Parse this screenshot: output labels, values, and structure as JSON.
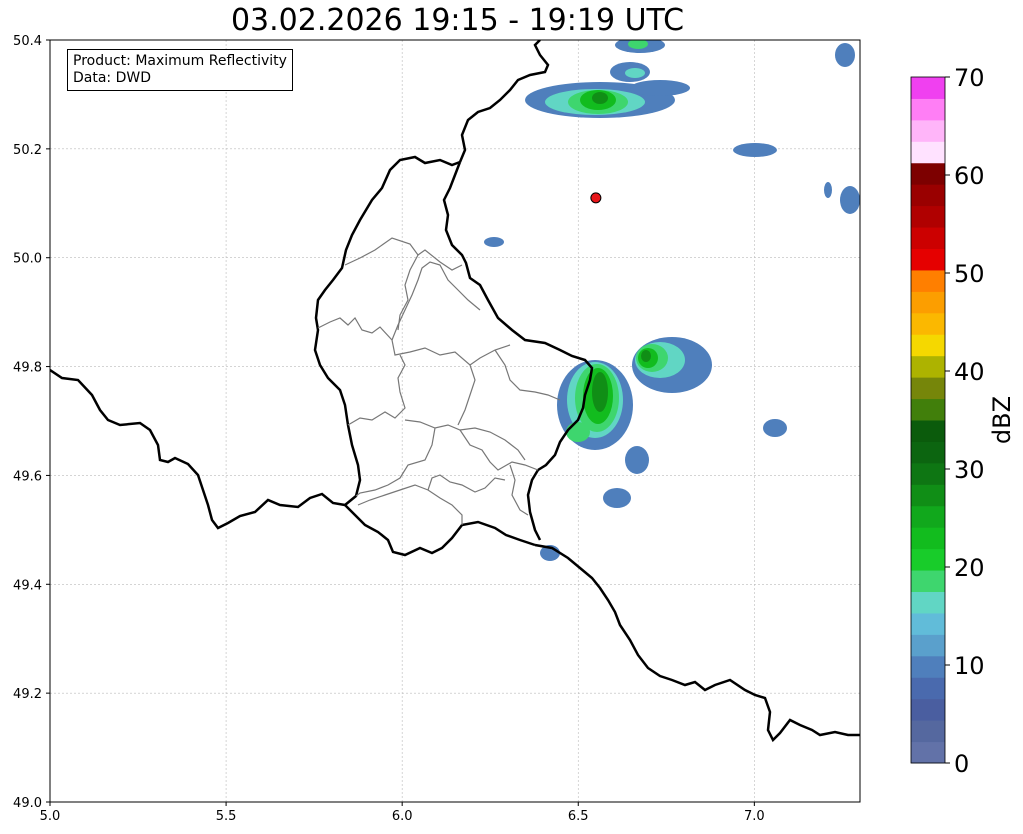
{
  "title": "03.02.2026 19:15 - 19:19 UTC",
  "info": {
    "product_line": "Product: Maximum Reflectivity",
    "data_line": "Data: DWD"
  },
  "axes": {
    "lon_min": 5.0,
    "lon_max": 7.3,
    "lat_min": 49.0,
    "lat_max": 50.4,
    "x_ticks": [
      "5.0",
      "5.5",
      "6.0",
      "6.5",
      "7.0"
    ],
    "y_ticks": [
      "49.0",
      "49.2",
      "49.4",
      "49.6",
      "49.8",
      "50.0",
      "50.2",
      "50.4"
    ],
    "grid": true
  },
  "marker": {
    "lon": 6.55,
    "lat": 50.11,
    "color": "#e8161a",
    "name": "location-marker"
  },
  "colorbar": {
    "label": "dBZ",
    "ticks": [
      "0",
      "10",
      "20",
      "30",
      "40",
      "50",
      "60",
      "70"
    ],
    "min": 0,
    "max": 70,
    "colors": [
      "#6272a8",
      "#55689f",
      "#4a5ea0",
      "#4a6aae",
      "#4f7fbc",
      "#5aa0cc",
      "#61bcd9",
      "#61d6c4",
      "#3ed66e",
      "#18cc2a",
      "#12bc1e",
      "#11a81c",
      "#108e16",
      "#0e7613",
      "#0c6510",
      "#0b5b0c",
      "#417f0b",
      "#76860a",
      "#adb300",
      "#f5d800",
      "#fbb800",
      "#fc9e00",
      "#ff7f00",
      "#e50000",
      "#cc0000",
      "#b00000",
      "#9a0000",
      "#7d0000",
      "#ffe2ff",
      "#ffb5f9",
      "#ff7ef5",
      "#f040f0"
    ]
  },
  "map": {
    "country_borders": "black-thick",
    "district_borders": "grey-thin"
  },
  "echoes": [
    {
      "lon": 6.57,
      "lat": 50.27,
      "intensity": "moderate"
    },
    {
      "lon": 6.7,
      "lat": 49.8,
      "intensity": "moderate"
    },
    {
      "lon": 6.55,
      "lat": 49.73,
      "intensity": "moderate"
    },
    {
      "lon": 6.66,
      "lat": 49.57,
      "intensity": "light"
    },
    {
      "lon": 7.05,
      "lat": 50.19,
      "intensity": "light"
    },
    {
      "lon": 7.05,
      "lat": 49.68,
      "intensity": "light"
    }
  ]
}
